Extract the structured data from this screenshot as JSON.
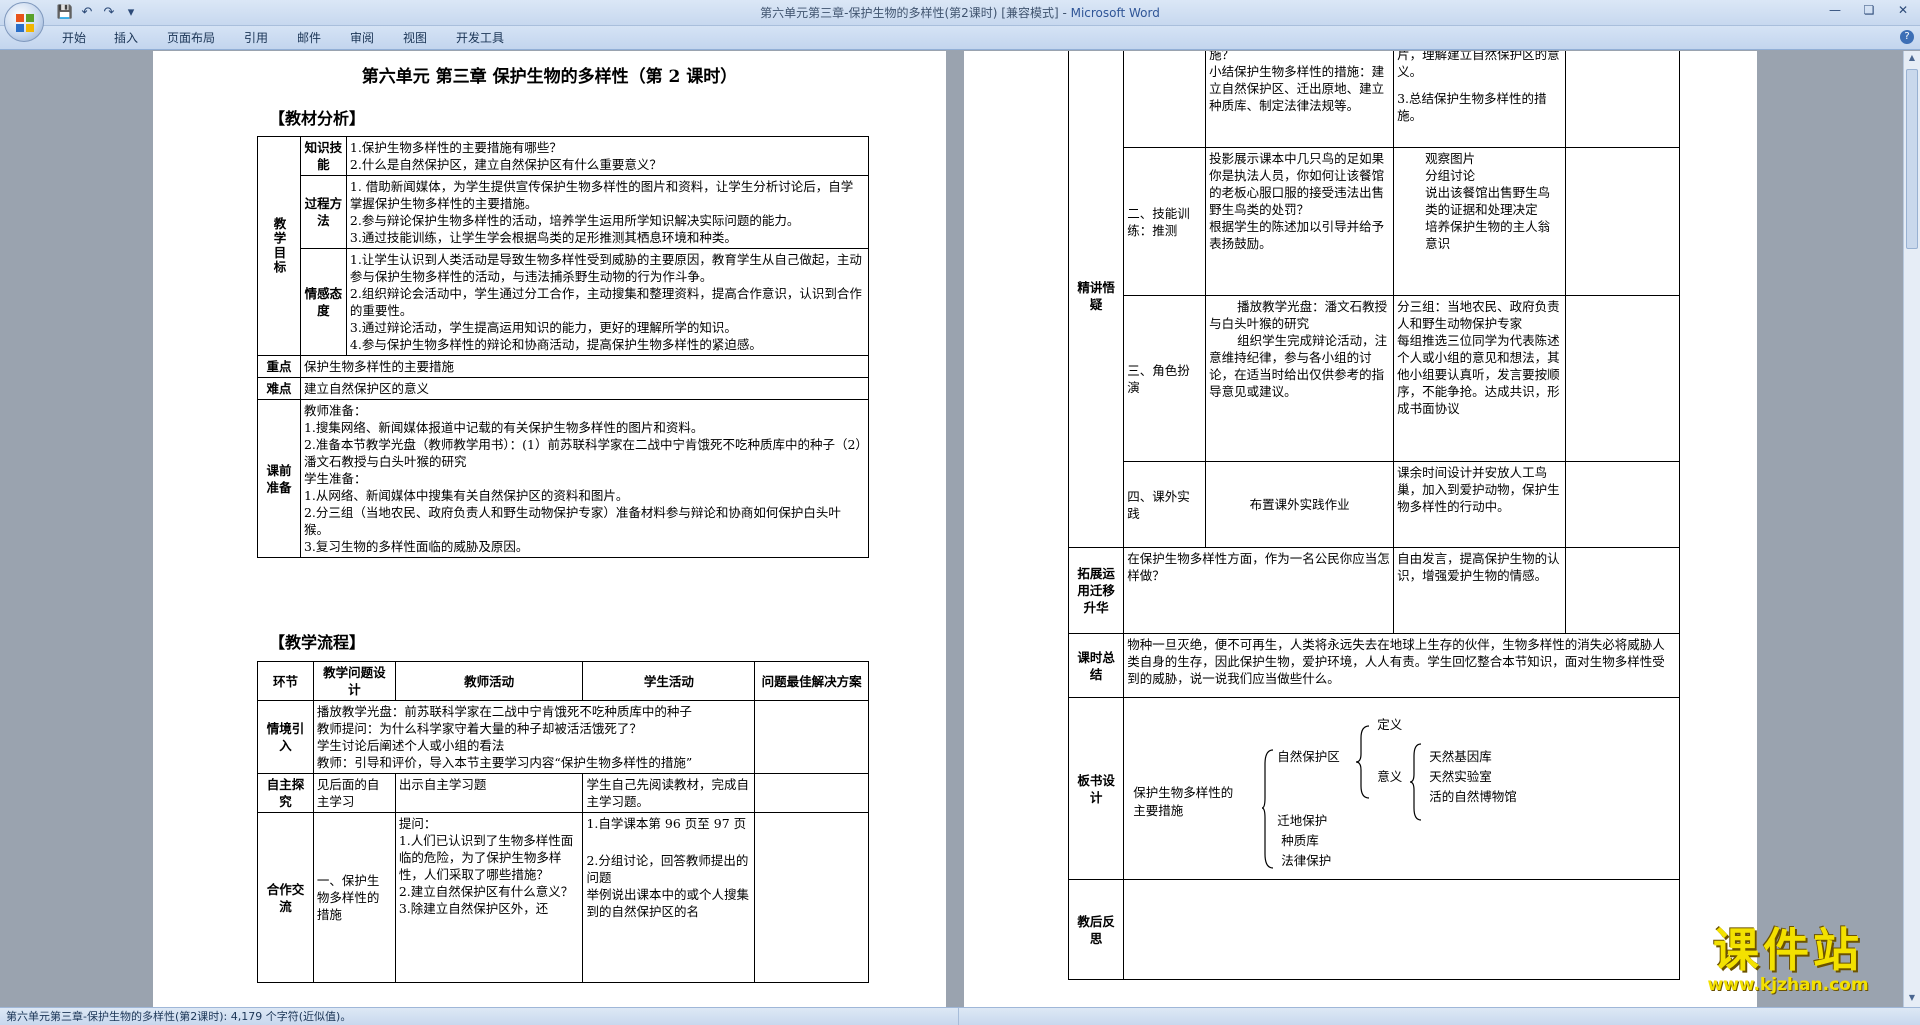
{
  "window": {
    "title": "第六单元第三章-保护生物的多样性(第2课时) [兼容模式] - ",
    "app_name": "Microsoft Word"
  },
  "ribbon": {
    "tabs": [
      "开始",
      "插入",
      "页面布局",
      "引用",
      "邮件",
      "审阅",
      "视图",
      "开发工具"
    ]
  },
  "status": {
    "text": "第六单元第三章-保护生物的多样性(第2课时): 4,179 个字符(近似值)。"
  },
  "doc": {
    "title": "第六单元  第三章  保护生物的多样性（第 2 课时）",
    "section_analysis": "【教材分析】",
    "section_flow": "【教学流程】",
    "analysis": {
      "goal_label": "教学目标",
      "knowledge_label": "知识技能",
      "knowledge": [
        "1.保护生物多样性的主要措施有哪些？",
        "2.什么是自然保护区，建立自然保护区有什么重要意义？"
      ],
      "process_label": "过程方法",
      "process": [
        "1. 借助新闻媒体，为学生提供宣传保护生物多样性的图片和资料，让学生分析讨论后，自学掌握保护生物多样性的主要措施。",
        "2.参与辩论保护生物多样性的活动，培养学生运用所学知识解决实际问题的能力。",
        "3.通过技能训练，让学生学会根据鸟类的足形推测其栖息环境和种类。"
      ],
      "emotion_label": "情感态度",
      "emotion": [
        "1.让学生认识到人类活动是导致生物多样性受到威胁的主要原因，教育学生从自己做起，主动参与保护生物多样性的活动，与违法捕杀野生动物的行为作斗争。",
        "2.组织辩论会活动中，学生通过分工合作，主动搜集和整理资料，提高合作意识，认识到合作的重要性。",
        "3.通过辩论活动，学生提高运用知识的能力，更好的理解所学的知识。",
        "4.参与保护生物多样性的辩论和协商活动，提高保护生物多样性的紧迫感。"
      ],
      "key_label": "重点",
      "key": "保护生物多样性的主要措施",
      "hard_label": "难点",
      "hard": "建立自然保护区的意义",
      "prep_label": "课前准备",
      "prep": [
        "教师准备：",
        "1.搜集网络、新闻媒体报道中记载的有关保护生物多样性的图片和资料。",
        "2.准备本节教学光盘（教师教学用书）：(1）前苏联科学家在二战中宁肯饿死不吃种质库中的种子（2）潘文石教授与白头叶猴的研究",
        "学生准备：",
        "1.从网络、新闻媒体中搜集有关自然保护区的资料和图片。",
        "2.分三组（当地农民、政府负责人和野生动物保护专家）准备材料参与辩论和协商如何保护白头叶猴。",
        "3.复习生物的多样性面临的威胁及原因。"
      ]
    },
    "flow": {
      "headers": [
        "环节",
        "教学问题设计",
        "教师活动",
        "学生活动",
        "问题最佳解决方案"
      ],
      "intro_label": "情境引入",
      "intro": [
        "播放教学光盘：前苏联科学家在二战中宁肯饿死不吃种质库中的种子",
        "教师提问：为什么科学家守着大量的种子却被活活饿死了？",
        "学生讨论后阐述个人或小组的看法",
        "教师：引导和评价，导入本节主要学习内容“保护生物多样性的措施”"
      ],
      "self_label": "自主探究",
      "self_q": "见后面的自主学习",
      "self_t": "出示自主学习题",
      "self_s": "学生自己先阅读教材，完成自主学习题。",
      "coop_label": "合作交流",
      "coop_q": "一、保护生物多样性的措施",
      "coop_t": [
        "提问：",
        "1.人们已认识到了生物多样性面临的危险，为了保护生物多样性，人们采取了哪些措施？",
        "2.建立自然保护区有什么意义？",
        "3.除建立自然保护区外，还"
      ],
      "coop_s": [
        "1.自学课本第 96 页至 97 页",
        "2.分组讨论，回答教师提出的问题",
        "举例说出课本中的或个人搜集到的自然保护区的名"
      ]
    },
    "page2": {
      "r1_t": [
        "施？",
        "小结保护生物多样性的措施：建立自然保护区、迁出原地、建立种质库、制定法律法规等。"
      ],
      "r1_s": [
        "片，理解建立自然保护区的意义。",
        "3.总结保护生物多样性的措施。"
      ],
      "jingjiang_label": "精讲悟疑",
      "skill_q": "二、技能训练：推测",
      "skill_t": [
        "投影展示课本中几只鸟的足如果你是执法人员，你如何让该餐馆的老板心服口服的接受违法出售野生鸟类的处罚？",
        "根据学生的陈述加以引导并给予表扬鼓励。"
      ],
      "skill_s": [
        "观察图片",
        "分组讨论",
        "说出该餐馆出售野生鸟类的证据和处理决定",
        "培养保护生物的主人翁意识"
      ],
      "role_q": "三、角色扮演",
      "role_t": [
        "播放教学光盘：潘文石教授与白头叶猴的研究",
        "组织学生完成辩论活动，注意维持纪律，参与各小组的讨论，在适当时给出仅供参考的指导意见或建议。"
      ],
      "role_s": [
        "分三组：当地农民、政府负责人和野生动物保护专家",
        "每组推选三位同学为代表陈述个人或小组的意见和想法，其他小组要认真听，发言要按顺序，不能争抢。达成共识，形成书面协议"
      ],
      "practice_q": "四、课外实践",
      "practice_t": "布置课外实践作业",
      "practice_s": "课余时间设计并安放人工鸟巢，加入到爱护动物，保护生物多样性的行动中。",
      "extend_label": "拓展运用迁移升华",
      "extend_t": "在保护生物多样性方面，作为一名公民你应当怎样做？",
      "extend_s": "自由发言，提高保护生物的认识，增强爱护生物的情感。",
      "summary_label": "课时总结",
      "summary": "物种一旦灭绝，便不可再生，人类将永远失去在地球上生存的伙伴，生物多样性的消失必将威胁人类自身的生存，因此保护生物，爱护环境，人人有责。学生回忆整合本节知识，面对生物多样性受到的威胁，说一说我们应当做些什么。",
      "board_label": "板书设计",
      "board": {
        "root": "保护生物多样性的主要措施",
        "reserve": "自然保护区",
        "definition": "定义",
        "meaning": "意义",
        "m1": "天然基因库",
        "m2": "天然实验室",
        "m3": "活的自然博物馆",
        "other1": "迁地保护",
        "other2": "种质库",
        "other3": "法律保护"
      },
      "reflect_label": "教后反思"
    }
  },
  "watermark": {
    "text": "课件站",
    "url": "www.kjzhan.com"
  },
  "colors": {
    "titlebar": "#dbe7f6",
    "workspace": "#9aa3af",
    "watermark": "#f3e100"
  }
}
